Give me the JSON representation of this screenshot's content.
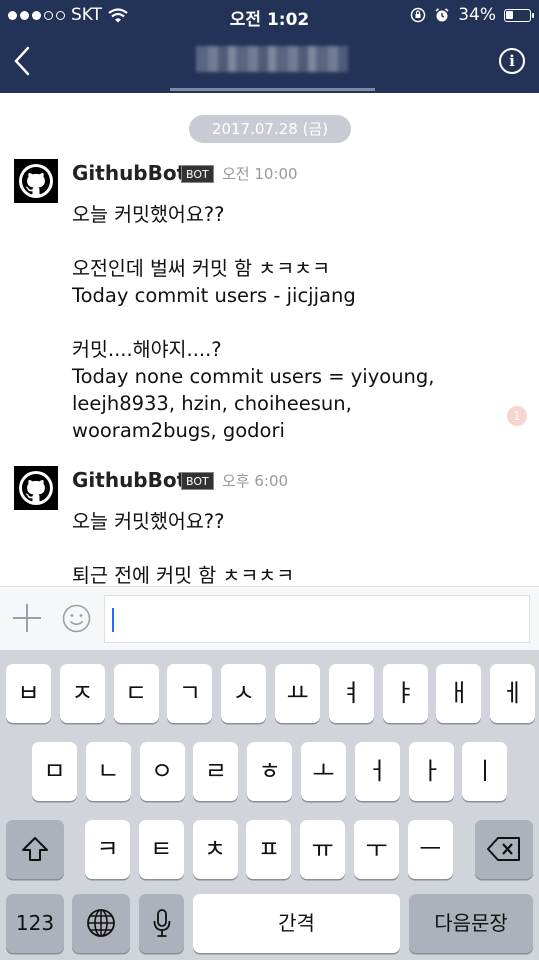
{
  "status_bar": {
    "carrier": "SKT",
    "time": "오전 1:02",
    "battery": "34%",
    "battery_level": 0.34
  },
  "header": {
    "back": "back-icon",
    "title_blurred": "",
    "info": "i"
  },
  "chat": {
    "date": "2017.07.28 (금)",
    "messages": [
      {
        "sender": "GithubBot",
        "badge": "BOT",
        "time": "오전 10:00",
        "text": "오늘 커밋했어요??\n\n오전인데 벌써 커밋 함 ㅊㅋㅊㅋ\nToday commit users - jicjjang\n\n커밋....해야지....?\nToday none commit users = yiyoung,\nleejh8933, hzin, choiheesun,\nwooram2bugs, godori",
        "unread": "1"
      },
      {
        "sender": "GithubBot",
        "badge": "BOT",
        "time": "오후 6:00",
        "text": "오늘 커밋했어요??\n\n퇴근 전에 커밋 함 ㅊㅋㅊㅋ"
      }
    ]
  },
  "input": {
    "value": ""
  },
  "keyboard": {
    "row1": [
      "ㅂ",
      "ㅈ",
      "ㄷ",
      "ㄱ",
      "ㅅ",
      "ㅛ",
      "ㅕ",
      "ㅑ",
      "ㅐ",
      "ㅔ"
    ],
    "row2": [
      "ㅁ",
      "ㄴ",
      "ㅇ",
      "ㄹ",
      "ㅎ",
      "ㅗ",
      "ㅓ",
      "ㅏ",
      "ㅣ"
    ],
    "row3": [
      "ㅋ",
      "ㅌ",
      "ㅊ",
      "ㅍ",
      "ㅠ",
      "ㅜ",
      "ㅡ"
    ],
    "numbers": "123",
    "space": "간격",
    "return": "다음문장"
  }
}
